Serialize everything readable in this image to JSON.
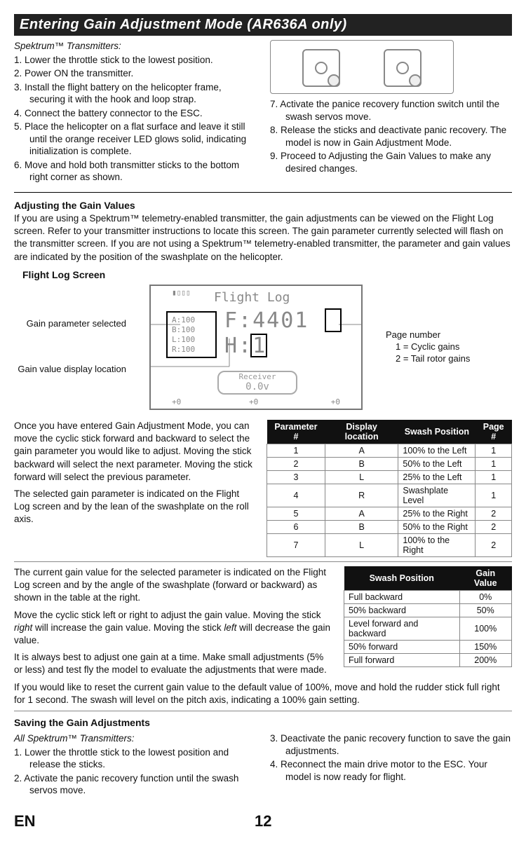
{
  "title": "Entering Gain Adjustment Mode (AR636A only)",
  "section1": {
    "header": "Spektrum™ Transmitters:",
    "left": [
      "1. Lower the throttle stick to the lowest position.",
      "2. Power ON the transmitter.",
      "3. Install the flight battery on the helicopter frame, securing it with the hook and loop strap.",
      "4. Connect the battery connector to the ESC.",
      "5. Place the helicopter on a flat surface and leave it still until the orange receiver LED glows solid, indicating initialization is complete.",
      "6. Move and hold both transmitter sticks to the bottom right corner as shown."
    ],
    "right": [
      "7. Activate the panice recovery function switch until the swash servos move.",
      "8. Release the sticks and deactivate panic recovery. The model is now in Gain Adjustment Mode.",
      "9. Proceed to Adjusting the Gain Values to make any desired changes."
    ]
  },
  "adjusting": {
    "header": "Adjusting the Gain Values",
    "text": "If you are using a Spektrum™ telemetry-enabled transmitter, the gain adjustments can be viewed on the Flight Log screen. Refer to your transmitter instructions to locate this screen. The gain parameter currently selected will flash on the transmitter screen. If you are not using a Spektrum™ telemetry-enabled transmitter, the parameter and gain values are indicated by the position of the swashplate on the helicopter."
  },
  "flightlog": {
    "header": "Flight Log Screen",
    "callouts": {
      "param": "Gain parameter selected",
      "value": "Gain value display location",
      "page_label": "Page number",
      "page_1": "1 = Cyclic gains",
      "page_2": "2 = Tail rotor gains"
    },
    "screen": {
      "title": "Flight Log",
      "f": "F:4401",
      "h": "H:1",
      "a": "A:100",
      "b": "B:100",
      "l": "L:100",
      "r": "R:100",
      "rx": "Receiver",
      "volts": "0.0v",
      "plus": "+0"
    }
  },
  "paramTable": {
    "intro1": "Once you have entered Gain Adjustment Mode, you can move the cyclic stick forward and backward to select the gain parameter you would like to adjust. Moving the stick backward will select the next parameter. Moving the stick forward will select the previous parameter.",
    "intro2": "The selected gain parameter is indicated on the Flight Log screen and by the lean of the swashplate on the roll axis.",
    "headers": [
      "Parameter #",
      "Display location",
      "Swash Position",
      "Page #"
    ],
    "rows": [
      [
        "1",
        "A",
        "100% to the Left",
        "1"
      ],
      [
        "2",
        "B",
        "50% to the Left",
        "1"
      ],
      [
        "3",
        "L",
        "25% to the Left",
        "1"
      ],
      [
        "4",
        "R",
        "Swashplate Level",
        "1"
      ],
      [
        "5",
        "A",
        "25% to the Right",
        "2"
      ],
      [
        "6",
        "B",
        "50% to the Right",
        "2"
      ],
      [
        "7",
        "L",
        "100% to the Right",
        "2"
      ]
    ]
  },
  "gainValue": {
    "p1": "The current gain value for the selected parameter is indicated on the Flight Log screen and by the angle of the swashplate (forward or backward) as shown in the table at the right.",
    "p2a": "Move the cyclic stick left or right to adjust the gain value. Moving the stick ",
    "p2b": "right",
    "p2c": " will increase the gain value. Moving the stick ",
    "p2d": "left",
    "p2e": " will decrease the gain value.",
    "p3": "It is always best to adjust one gain at a time. Make small adjustments (5% or less) and test fly the model to evaluate the adjustments that were made.",
    "p4": "If you would like to reset the current gain value to the default value of 100%, move and hold the rudder stick full right for 1 second. The swash will level on the pitch axis, indicating a 100% gain setting.",
    "table": {
      "headers": [
        "Swash Position",
        "Gain Value"
      ],
      "rows": [
        [
          "Full backward",
          "0%"
        ],
        [
          "50% backward",
          "50%"
        ],
        [
          "Level forward and backward",
          "100%"
        ],
        [
          "50% forward",
          "150%"
        ],
        [
          " Full forward",
          "200%"
        ]
      ]
    }
  },
  "saving": {
    "header": "Saving the Gain Adjustments",
    "sub": "All Spektrum™ Transmitters:",
    "left": [
      "1. Lower the throttle stick to the lowest position and release the sticks.",
      "2. Activate the panic recovery function until the swash servos move."
    ],
    "right": [
      "3. Deactivate the panic recovery function to save the gain adjustments.",
      "4. Reconnect the main drive motor to the ESC. Your model is now ready for flight."
    ]
  },
  "footer": {
    "lang": "EN",
    "page": "12"
  }
}
